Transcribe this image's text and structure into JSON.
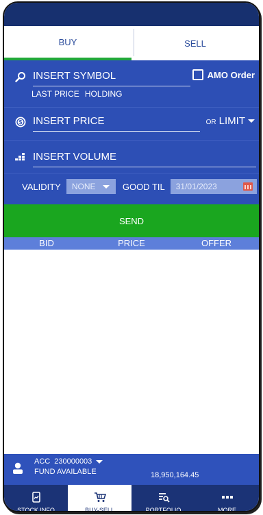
{
  "tabs": [
    {
      "label": "BUY",
      "active": true
    },
    {
      "label": "SELL",
      "active": false
    }
  ],
  "form": {
    "symbol_placeholder": "INSERT SYMBOL",
    "amo_label": "AMO Order",
    "last_price_label": "LAST PRICE",
    "holding_label": "HOLDING",
    "price_placeholder": "INSERT PRICE",
    "or_label": "OR",
    "limit_value": "LIMIT",
    "volume_placeholder": "INSERT VOLUME",
    "validity_label": "VALIDITY",
    "validity_value": "NONE",
    "good_til_label": "GOOD TIL",
    "good_til_date": "31/01/2023"
  },
  "send_label": "SEND",
  "orderbook": {
    "headers": [
      "BID",
      "PRICE",
      "OFFER"
    ]
  },
  "account": {
    "acc_label": "ACC",
    "acc_number": "230000003",
    "fund_label": "FUND AVAILABLE",
    "fund_amount": "18,950,164.45"
  },
  "nav": [
    {
      "label": "STOCK INFO",
      "icon": "stock-info-icon",
      "active": false
    },
    {
      "label": "BUY-SELL",
      "icon": "cart-icon",
      "active": true
    },
    {
      "label": "PORTFOLIO",
      "icon": "portfolio-icon",
      "active": false
    },
    {
      "label": "MORE",
      "icon": "more-icon",
      "active": false
    }
  ],
  "colors": {
    "primary": "#2d4fb5",
    "dark": "#1b3376",
    "send": "#1aa61f",
    "active_tab": "#22a83a"
  }
}
